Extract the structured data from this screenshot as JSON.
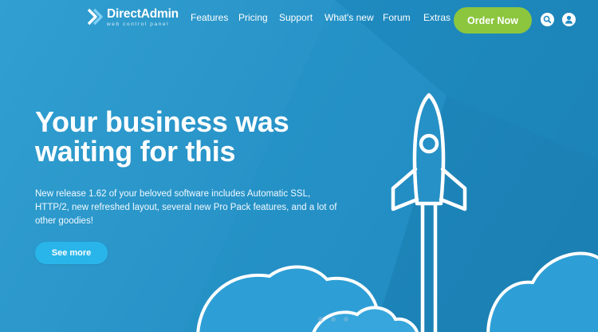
{
  "brand": {
    "name": "DirectAdmin",
    "tagline": "web control panel"
  },
  "nav": {
    "items": [
      {
        "label": "Features"
      },
      {
        "label": "Pricing"
      },
      {
        "label": "Support"
      },
      {
        "label": "What's new"
      },
      {
        "label": "Forum"
      },
      {
        "label": "Extras"
      }
    ],
    "order_label": "Order Now",
    "search_icon": "search-icon",
    "account_icon": "user-icon"
  },
  "hero": {
    "title": "Your business was waiting for this",
    "description": "New release 1.62 of your beloved software includes Automatic SSL, HTTP/2, new refreshed layout, several new Pro Pack features, and a lot of other goodies!",
    "cta_label": "See more"
  },
  "carousel": {
    "slides": 3,
    "active": 1
  },
  "colors": {
    "background": "#2190c6",
    "order_button": "#8cc63f",
    "cta_button": "#29b5ea"
  }
}
